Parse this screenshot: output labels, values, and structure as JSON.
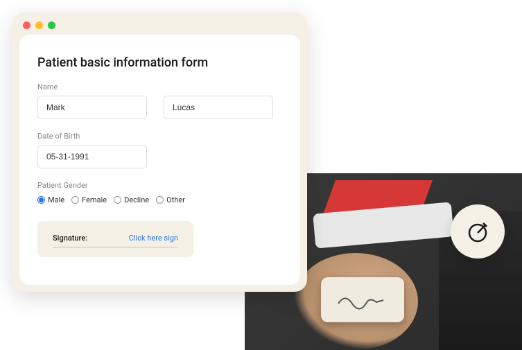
{
  "form": {
    "title": "Patient basic information form",
    "name_label": "Name",
    "first_name": "Mark",
    "last_name": "Lucas",
    "dob_label": "Date of Birth",
    "dob_value": "05-31-1991",
    "gender_label": "Patient Gender",
    "gender_options": {
      "male": "Male",
      "female": "Female",
      "decline": "Decline",
      "other": "Other"
    },
    "signature_label": "Signature:",
    "signature_link": "Click here sign"
  }
}
